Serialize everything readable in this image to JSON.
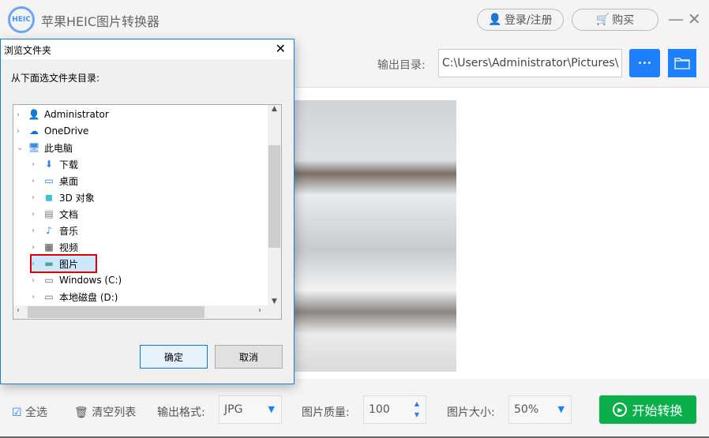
{
  "app": {
    "logo_text": "HEIC",
    "title": "苹果HEIC图片转换器",
    "login": "登录/注册",
    "buy": "购买",
    "minimize": "—",
    "close": "✕"
  },
  "output": {
    "label": "输出目录:",
    "path": "C:\\Users\\Administrator\\Pictures\\",
    "more": "•••"
  },
  "dialog": {
    "title": "浏览文件夹",
    "close": "✕",
    "label": "从下面选文件夹目录:",
    "ok": "确定",
    "cancel": "取消",
    "items": [
      {
        "label": "Administrator",
        "icon": "user-icon",
        "level": 0,
        "expanded": false
      },
      {
        "label": "OneDrive",
        "icon": "cloud-icon",
        "level": 0,
        "expanded": false
      },
      {
        "label": "此电脑",
        "icon": "computer-icon",
        "level": 0,
        "expanded": true
      },
      {
        "label": "下载",
        "icon": "download-icon",
        "level": 1,
        "expanded": false
      },
      {
        "label": "桌面",
        "icon": "desktop-icon",
        "level": 1,
        "expanded": false
      },
      {
        "label": "3D 对象",
        "icon": "cube-icon",
        "level": 1,
        "expanded": false
      },
      {
        "label": "文档",
        "icon": "document-icon",
        "level": 1,
        "expanded": false
      },
      {
        "label": "音乐",
        "icon": "music-icon",
        "level": 1,
        "expanded": false
      },
      {
        "label": "视频",
        "icon": "video-icon",
        "level": 1,
        "expanded": false
      },
      {
        "label": "图片",
        "icon": "picture-icon",
        "level": 1,
        "expanded": false,
        "selected": true
      },
      {
        "label": "Windows (C:)",
        "icon": "drive-icon",
        "level": 1,
        "expanded": false
      },
      {
        "label": "本地磁盘 (D:)",
        "icon": "drive-icon",
        "level": 1,
        "expanded": false
      }
    ]
  },
  "bottom": {
    "select_all": "全选",
    "clear": "清空列表",
    "format_label": "输出格式:",
    "format": "JPG",
    "quality_label": "图片质量:",
    "quality": "100",
    "size_label": "图片大小:",
    "size": "50%",
    "start": "开始转换"
  },
  "colors": {
    "accent": "#1e7ffb",
    "start": "#0bb04a",
    "highlight": "#e00000"
  }
}
